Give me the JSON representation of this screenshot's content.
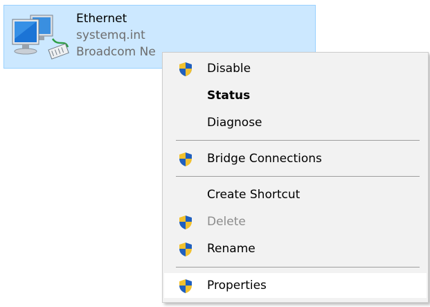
{
  "adapter": {
    "name": "Ethernet",
    "domain": "systemq.int",
    "device": "Broadcom Ne",
    "icon": "network-adapter-icon",
    "selection_bg": "#cce8ff",
    "selection_border": "#99d1ff"
  },
  "menu": {
    "items": [
      {
        "label": "Disable",
        "icon": "uac-shield-icon",
        "bold": false,
        "disabled": false
      },
      {
        "label": "Status",
        "icon": "",
        "bold": true,
        "disabled": false
      },
      {
        "label": "Diagnose",
        "icon": "",
        "bold": false,
        "disabled": false
      },
      {
        "label": "Bridge Connections",
        "icon": "uac-shield-icon",
        "bold": false,
        "disabled": false
      },
      {
        "label": "Create Shortcut",
        "icon": "",
        "bold": false,
        "disabled": false
      },
      {
        "label": "Delete",
        "icon": "uac-shield-icon",
        "bold": false,
        "disabled": true
      },
      {
        "label": "Rename",
        "icon": "uac-shield-icon",
        "bold": false,
        "disabled": false
      },
      {
        "label": "Properties",
        "icon": "uac-shield-icon",
        "bold": false,
        "disabled": false,
        "hovered": true
      }
    ],
    "background": "#f2f2f2",
    "hover_background": "#ffffff"
  }
}
